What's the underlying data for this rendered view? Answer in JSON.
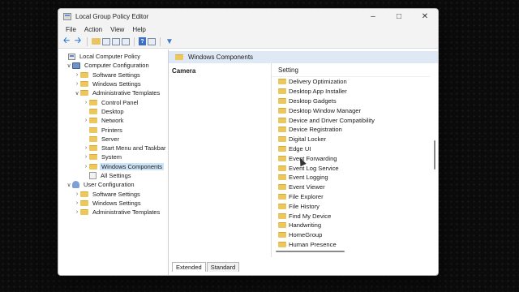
{
  "window": {
    "title": "Local Group Policy Editor"
  },
  "menu": [
    "File",
    "Action",
    "View",
    "Help"
  ],
  "tree": [
    {
      "label": "Local Computer Policy",
      "icon": "policy-icon",
      "indent": 0,
      "exp": "",
      "selected": false
    },
    {
      "label": "Computer Configuration",
      "icon": "computer-icon",
      "indent": 1,
      "exp": "v",
      "selected": false
    },
    {
      "label": "Software Settings",
      "icon": "folder-icon",
      "indent": 2,
      "exp": ">",
      "selected": false
    },
    {
      "label": "Windows Settings",
      "icon": "folder-icon",
      "indent": 2,
      "exp": ">",
      "selected": false
    },
    {
      "label": "Administrative Templates",
      "icon": "folder-icon",
      "indent": 2,
      "exp": "v",
      "selected": false
    },
    {
      "label": "Control Panel",
      "icon": "folder-icon",
      "indent": 3,
      "exp": ">",
      "selected": false
    },
    {
      "label": "Desktop",
      "icon": "folder-icon",
      "indent": 3,
      "exp": "",
      "selected": false
    },
    {
      "label": "Network",
      "icon": "folder-icon",
      "indent": 3,
      "exp": ">",
      "selected": false
    },
    {
      "label": "Printers",
      "icon": "folder-icon",
      "indent": 3,
      "exp": "",
      "selected": false
    },
    {
      "label": "Server",
      "icon": "folder-icon",
      "indent": 3,
      "exp": "",
      "selected": false
    },
    {
      "label": "Start Menu and Taskbar",
      "icon": "folder-icon",
      "indent": 3,
      "exp": ">",
      "selected": false
    },
    {
      "label": "System",
      "icon": "folder-icon",
      "indent": 3,
      "exp": ">",
      "selected": false
    },
    {
      "label": "Windows Components",
      "icon": "folder-icon",
      "indent": 3,
      "exp": ">",
      "selected": true
    },
    {
      "label": "All Settings",
      "icon": "pages-icon",
      "indent": 3,
      "exp": "",
      "selected": false
    },
    {
      "label": "User Configuration",
      "icon": "user-icon",
      "indent": 1,
      "exp": "v",
      "selected": false
    },
    {
      "label": "Software Settings",
      "icon": "folder-icon",
      "indent": 2,
      "exp": ">",
      "selected": false
    },
    {
      "label": "Windows Settings",
      "icon": "folder-icon",
      "indent": 2,
      "exp": ">",
      "selected": false
    },
    {
      "label": "Administrative Templates",
      "icon": "folder-icon",
      "indent": 2,
      "exp": ">",
      "selected": false
    }
  ],
  "header": {
    "title": "Windows Components"
  },
  "detail": {
    "selected_item": "Camera"
  },
  "list": {
    "column": "Setting",
    "items": [
      "Delivery Optimization",
      "Desktop App Installer",
      "Desktop Gadgets",
      "Desktop Window Manager",
      "Device and Driver Compatibility",
      "Device Registration",
      "Digital Locker",
      "Edge UI",
      "Event Forwarding",
      "Event Log Service",
      "Event Logging",
      "Event Viewer",
      "File Explorer",
      "File History",
      "Find My Device",
      "Handwriting",
      "HomeGroup",
      "Human Presence"
    ]
  },
  "tabs": [
    "Extended",
    "Standard"
  ]
}
